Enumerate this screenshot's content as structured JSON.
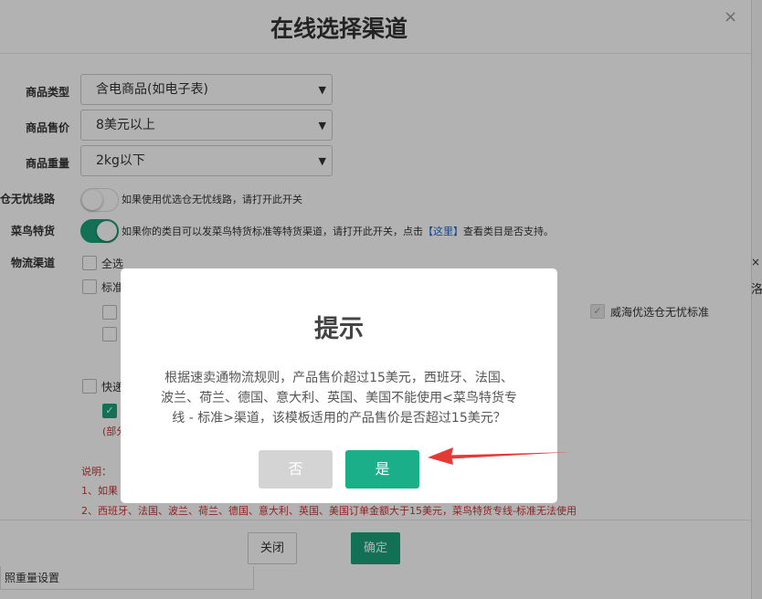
{
  "dialog": {
    "title": "在线选择渠道",
    "close_icon": "×",
    "edge_close_icon": "×",
    "edge_char": "洛"
  },
  "form": {
    "product_type": {
      "label": "商品类型",
      "value": "含电商品(如电子表)"
    },
    "product_price": {
      "label": "商品售价",
      "value": "8美元以上"
    },
    "product_weight": {
      "label": "商品重量",
      "value": "2kg以下"
    },
    "worry_free": {
      "label": "仓无忧线路",
      "toggle": "off",
      "hint": "如果使用优选仓无忧线路，请打开此开关"
    },
    "cainiao": {
      "label": "菜鸟特货",
      "toggle": "on",
      "hint_before": "如果你的类目可以发菜鸟特货标准等特货渠道，请打开此开关，点击",
      "link": "【这里】",
      "hint_after": "查看类目是否支持。"
    },
    "logistics": {
      "label": "物流渠道",
      "select_all": "全选",
      "standard_partial": "标准",
      "express_partial": "快递",
      "partial_red": "(部分",
      "weihai_label": "威海优选仓无忧标准"
    },
    "notes": {
      "title": "说明：",
      "line1_partial": "1、如果",
      "line2": "2、西班牙、法国、波兰、荷兰、德国、意大利、英国、美国订单金额大于15美元，菜鸟特货专线-标准无法使用"
    }
  },
  "footer": {
    "close_label": "关闭",
    "ok_label": "确定",
    "under_text": "照重量设置"
  },
  "modal": {
    "title": "提示",
    "body_lines": [
      "根据速卖通物流规则，产品售价超过15美元，西班牙、法国、",
      "波兰、荷兰、德国、意大利、英国、美国不能使用<菜鸟特货专",
      "线 - 标准>渠道，该模板适用的产品售价是否超过15美元？"
    ],
    "no_label": "否",
    "yes_label": "是"
  },
  "colors": {
    "accent": "#1aa37a",
    "modal_yes": "#1aaf89",
    "modal_no": "#d4d4d4",
    "arrow": "#e53935",
    "note_red": "#cc3333"
  },
  "icons": {
    "caret": "chevron-down-icon",
    "check": "check-icon",
    "close": "close-icon",
    "pointer": "red-arrow-icon"
  }
}
